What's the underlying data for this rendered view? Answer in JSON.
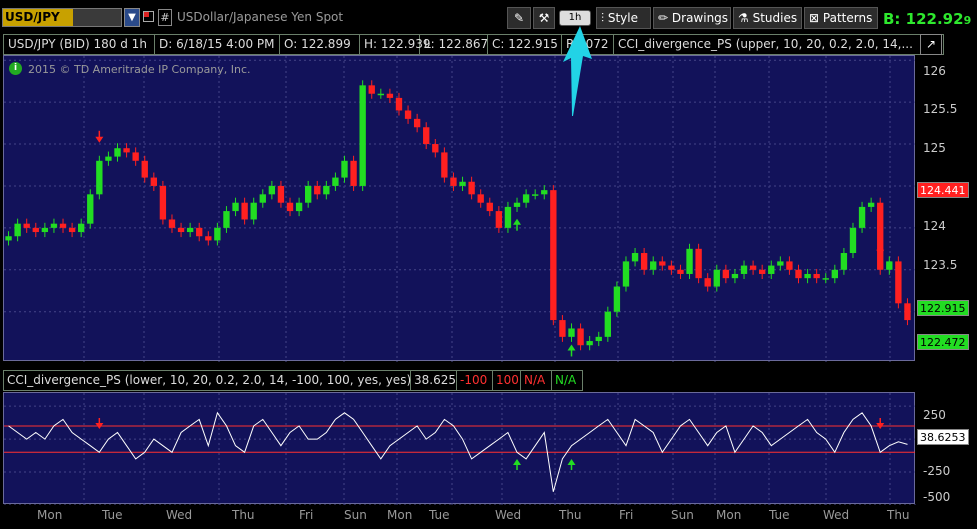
{
  "toolbar": {
    "symbol": "USD/JPY",
    "description": "USDollar/Japanese Yen Spot",
    "aggregation": "1h",
    "style_label": "Style",
    "drawings_label": "Drawings",
    "studies_label": "Studies",
    "patterns_label": "Patterns",
    "bid_label": "B:",
    "bid_main": "122.92",
    "bid_frac": "9"
  },
  "infobar": {
    "instrument": "USD/JPY (BID) 180 d 1h",
    "date": "D: 6/18/15 4:00 PM",
    "open": "O: 122.899",
    "high": "H: 122.939",
    "low": "L: 122.867",
    "close": "C: 122.915",
    "range": "R: .072",
    "study": "CCI_divergence_PS (upper, 10, 20, 0.2, 2.0, 14,..."
  },
  "copyright": "2015 © TD Ameritrade IP Company, Inc.",
  "upper_axis": {
    "ticks": [
      "126",
      "125.5",
      "125",
      "124",
      "123.5"
    ],
    "tag_red": "124.441",
    "tag_green1": "122.915",
    "tag_green2": "122.472"
  },
  "studybar": {
    "label": "CCI_divergence_PS (lower, 10, 20, 0.2, 2.0, 14, -100, 100, yes, yes)",
    "value": "38.625",
    "neg100": "-100",
    "pos100": "100",
    "na_red": "N/A",
    "na_green": "N/A"
  },
  "lower_axis": {
    "ticks": [
      "250",
      "-250",
      "-500"
    ],
    "current": "38.6253"
  },
  "x_labels": [
    "Mon",
    "Tue",
    "Wed",
    "Thu",
    "Fri",
    "Sun",
    "Mon",
    "Tue",
    "Wed",
    "Thu",
    "Fri",
    "Sun",
    "Mon",
    "Tue",
    "Wed",
    "Thu"
  ],
  "colors": {
    "chart_bg": "#12125a",
    "up_candle": "#22dd22",
    "down_candle": "#ff2020",
    "cci_line": "#ffffff",
    "cci_levels": "#ff3030",
    "bid_green": "#2ee82e",
    "symbol_bg": "#c8a100"
  },
  "chart_data": [
    {
      "type": "line",
      "title": "USD/JPY (BID) 180 d 1h",
      "x_labels": [
        "Mon",
        "Tue",
        "Wed",
        "Thu",
        "Fri",
        "Sun",
        "Mon",
        "Tue",
        "Wed",
        "Thu",
        "Fri",
        "Sun",
        "Mon",
        "Tue",
        "Wed",
        "Thu"
      ],
      "ylim": [
        122.4,
        126.05
      ],
      "series": [
        {
          "values": [
            123.9,
            124.05,
            124.0,
            123.95,
            124.0,
            124.05,
            124.0,
            123.95,
            124.05,
            124.4,
            124.8,
            124.85,
            124.95,
            124.9,
            124.8,
            124.6,
            124.5,
            124.1,
            124.0,
            123.95,
            124.0,
            123.9,
            123.85,
            124.0,
            124.2,
            124.3,
            124.1,
            124.3,
            124.4,
            124.5,
            124.3,
            124.2,
            124.3,
            124.5,
            124.4,
            124.5,
            124.6,
            124.8,
            124.5,
            125.7,
            125.6,
            125.6,
            125.55,
            125.4,
            125.3,
            125.2,
            125.0,
            124.9,
            124.6,
            124.5,
            124.55,
            124.4,
            124.3,
            124.2,
            124.0,
            124.25,
            124.3,
            124.4,
            124.4,
            124.45,
            122.9,
            122.7,
            122.8,
            122.6,
            122.65,
            122.7,
            123.0,
            123.3,
            123.6,
            123.7,
            123.5,
            123.6,
            123.55,
            123.5,
            123.45,
            123.75,
            123.4,
            123.3,
            123.5,
            123.4,
            123.45,
            123.55,
            123.5,
            123.45,
            123.55,
            123.6,
            123.5,
            123.4,
            123.45,
            123.4,
            123.4,
            123.5,
            123.7,
            124.0,
            124.25,
            124.3,
            123.5,
            123.6,
            123.1,
            122.9
          ]
        }
      ]
    },
    {
      "type": "line",
      "title": "CCI_divergence_PS",
      "ylim": [
        -500,
        350
      ],
      "series": [
        {
          "values": [
            100,
            50,
            0,
            50,
            0,
            100,
            150,
            50,
            0,
            -50,
            -100,
            0,
            50,
            -50,
            -150,
            -100,
            0,
            -50,
            -100,
            50,
            100,
            150,
            -50,
            200,
            100,
            -50,
            -100,
            100,
            150,
            50,
            -50,
            50,
            100,
            0,
            0,
            50,
            150,
            200,
            150,
            50,
            -50,
            -150,
            -50,
            0,
            50,
            100,
            0,
            50,
            150,
            100,
            0,
            -150,
            -100,
            -50,
            0,
            50,
            -100,
            -150,
            -50,
            50,
            -400,
            -150,
            -50,
            0,
            50,
            100,
            150,
            50,
            -50,
            150,
            100,
            50,
            -100,
            0,
            100,
            150,
            50,
            -50,
            50,
            100,
            -100,
            0,
            100,
            50,
            -50,
            0,
            50,
            100,
            150,
            50,
            0,
            -100,
            50,
            150,
            200,
            100,
            -100,
            -50,
            -20,
            -40
          ]
        }
      ]
    }
  ]
}
